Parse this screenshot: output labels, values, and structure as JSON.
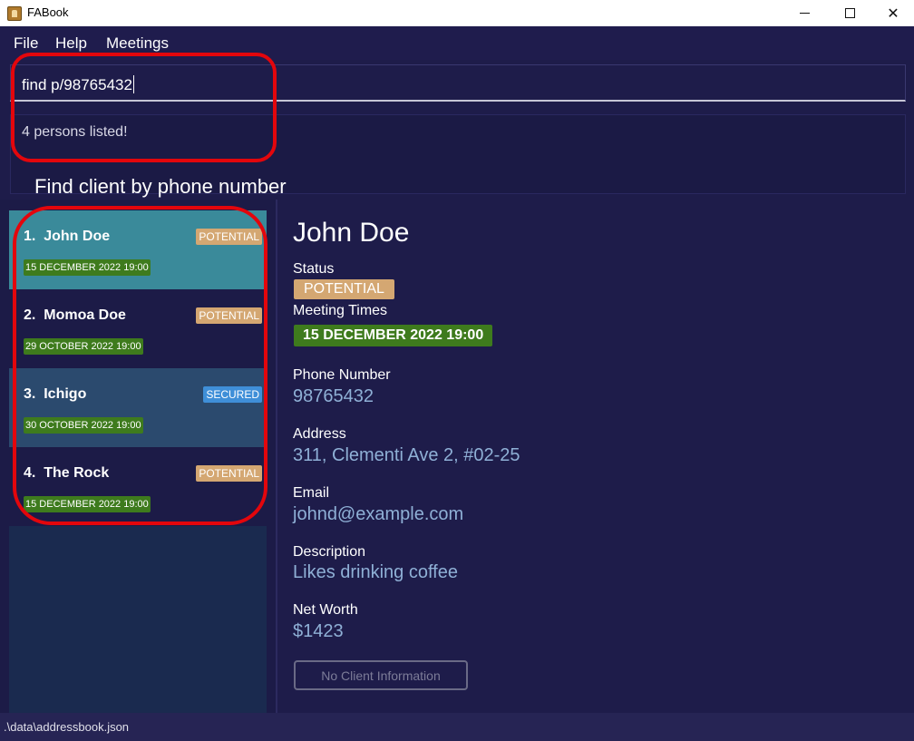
{
  "window": {
    "title": "FABook"
  },
  "menu": {
    "items": [
      "File",
      "Help",
      "Meetings"
    ]
  },
  "command": {
    "value": "find p/98765432"
  },
  "result": {
    "message": "4 persons listed!"
  },
  "annotation": {
    "label": "Find client by phone number",
    "color": "#e3060c"
  },
  "persons": [
    {
      "index": "1.",
      "name": "John Doe",
      "tag": "POTENTIAL",
      "meeting": "15 DECEMBER 2022 19:00",
      "selected": true
    },
    {
      "index": "2.",
      "name": "Momoa Doe",
      "tag": "POTENTIAL",
      "meeting": "29 OCTOBER 2022 19:00",
      "selected": false
    },
    {
      "index": "3.",
      "name": "Ichigo",
      "tag": "SECURED",
      "meeting": "30 OCTOBER 2022 19:00",
      "selected": false
    },
    {
      "index": "4.",
      "name": "The Rock",
      "tag": "POTENTIAL",
      "meeting": "15 DECEMBER 2022 19:00",
      "selected": false
    }
  ],
  "detail": {
    "name": "John Doe",
    "status_label": "Status",
    "status": "POTENTIAL",
    "meeting_label": "Meeting Times",
    "meeting": "15 DECEMBER 2022 19:00",
    "phone_label": "Phone Number",
    "phone": "98765432",
    "address_label": "Address",
    "address": "311, Clementi Ave 2, #02-25",
    "email_label": "Email",
    "email": "johnd@example.com",
    "description_label": "Description",
    "description": "Likes drinking coffee",
    "networth_label": "Net Worth",
    "networth": "$1423",
    "no_info_button": "No Client Information"
  },
  "statusbar": {
    "path": ".\\data\\addressbook.json"
  },
  "colors": {
    "potential": "#d4a772",
    "secured": "#3f8fd8",
    "meeting": "#3e7b1d",
    "selected_card": "#3a8a9a",
    "card_alt": "#2b4a6e",
    "background": "#1e1c4a"
  }
}
